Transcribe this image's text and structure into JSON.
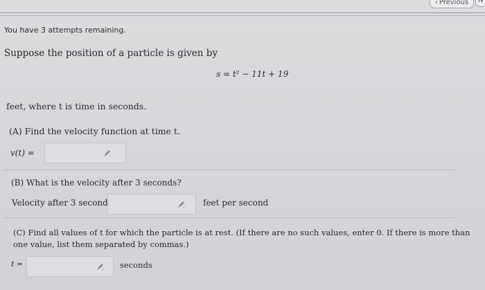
{
  "nav": {
    "previous_label": "Previous",
    "next_label": "N"
  },
  "status": {
    "attempts_text": "You have 3 attempts remaining."
  },
  "problem": {
    "intro": "Suppose the position of a particle is given by",
    "equation": "s = t² − 11t + 19",
    "units_text": "feet, where t is time in seconds."
  },
  "part_a": {
    "question": "(A) Find the velocity function at time t.",
    "field_label": "v(t) =",
    "value": ""
  },
  "part_b": {
    "question": "(B) What is the velocity after 3 seconds?",
    "field_label": "Velocity after 3 seconds =",
    "value": "",
    "unit": "feet per second"
  },
  "part_c": {
    "question": "(C) Find all values of t for which the particle is at rest. (If there are no such values, enter 0. If there is more than one value, list them separated by commas.)",
    "field_label": "t =",
    "value": "",
    "unit": "seconds"
  },
  "icons": {
    "pencil": "pencil-icon",
    "chevron_left": "chevron-left-icon"
  }
}
